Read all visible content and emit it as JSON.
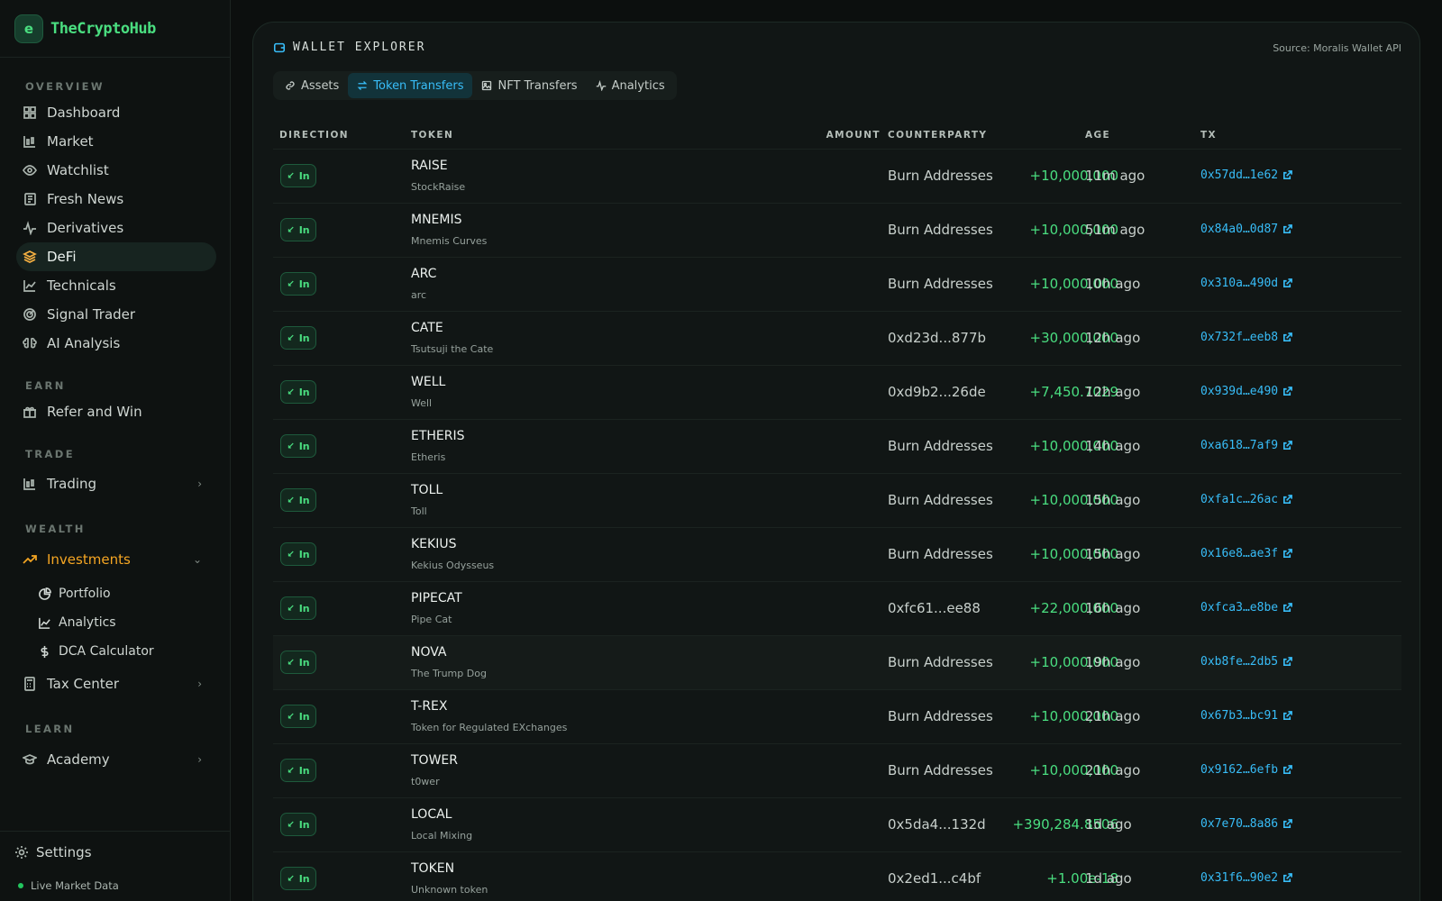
{
  "brand": {
    "name": "TheCryptoHub",
    "logo_glyph": "e"
  },
  "sidebar": {
    "sections": {
      "overview": "OVERVIEW",
      "earn": "EARN",
      "trade": "TRADE",
      "wealth": "WEALTH",
      "learn": "LEARN"
    },
    "overview_items": [
      {
        "label": "Dashboard",
        "icon": "grid-icon"
      },
      {
        "label": "Market",
        "icon": "candles-icon"
      },
      {
        "label": "Watchlist",
        "icon": "eye-icon"
      },
      {
        "label": "Fresh News",
        "icon": "newspaper-icon"
      },
      {
        "label": "Derivatives",
        "icon": "pulse-icon"
      },
      {
        "label": "DeFi",
        "icon": "layers-icon"
      },
      {
        "label": "Technicals",
        "icon": "line-chart-icon"
      },
      {
        "label": "Signal Trader",
        "icon": "radar-icon"
      },
      {
        "label": "AI Analysis",
        "icon": "brain-icon"
      }
    ],
    "earn_items": [
      {
        "label": "Refer and Win",
        "icon": "gift-icon"
      }
    ],
    "trade_items": [
      {
        "label": "Trading",
        "icon": "candles-icon"
      }
    ],
    "wealth_items": [
      {
        "label": "Investments",
        "icon": "trending-up-icon"
      },
      {
        "label": "Portfolio",
        "icon": "pie-icon"
      },
      {
        "label": "Analytics",
        "icon": "line-chart-icon"
      },
      {
        "label": "DCA Calculator",
        "icon": "dollar-icon"
      },
      {
        "label": "Tax Center",
        "icon": "calculator-icon"
      }
    ],
    "learn_items": [
      {
        "label": "Academy",
        "icon": "graduation-cap-icon"
      }
    ],
    "footer": {
      "settings": "Settings",
      "live": "Live Market Data"
    }
  },
  "panel": {
    "title": "WALLET EXPLORER",
    "source": "Source: Moralis Wallet API",
    "tabs": [
      {
        "label": "Assets",
        "icon": "link-icon"
      },
      {
        "label": "Token Transfers",
        "icon": "swap-icon"
      },
      {
        "label": "NFT Transfers",
        "icon": "image-icon"
      },
      {
        "label": "Analytics",
        "icon": "pulse-icon"
      }
    ],
    "active_tab": "Token Transfers",
    "columns": {
      "direction": "DIRECTION",
      "token": "TOKEN",
      "amount": "AMOUNT",
      "counterparty": "COUNTERPARTY",
      "age": "AGE",
      "tx": "TX"
    },
    "rows": [
      {
        "dir": "In",
        "sym": "RAISE",
        "name": "StockRaise",
        "amount": "+10,000,000",
        "cp": "Burn Addresses",
        "age": "11m ago",
        "tx": "0x57dd…1e62"
      },
      {
        "dir": "In",
        "sym": "MNEMIS",
        "name": "Mnemis Curves",
        "amount": "+10,000,000",
        "cp": "Burn Addresses",
        "age": "51m ago",
        "tx": "0x84a0…0d87"
      },
      {
        "dir": "In",
        "sym": "ARC",
        "name": "arc",
        "amount": "+10,000,000",
        "cp": "Burn Addresses",
        "age": "10h ago",
        "tx": "0x310a…490d"
      },
      {
        "dir": "In",
        "sym": "CATE",
        "name": "Tsutsuji the Cate",
        "amount": "+30,000,000",
        "cp": "0xd23d...877b",
        "age": "12h ago",
        "tx": "0x732f…eeb8"
      },
      {
        "dir": "In",
        "sym": "WELL",
        "name": "Well",
        "amount": "+7,450.7029",
        "cp": "0xd9b2...26de",
        "age": "12h ago",
        "tx": "0x939d…e490"
      },
      {
        "dir": "In",
        "sym": "ETHERIS",
        "name": "Etheris",
        "amount": "+10,000,000",
        "cp": "Burn Addresses",
        "age": "14h ago",
        "tx": "0xa618…7af9"
      },
      {
        "dir": "In",
        "sym": "TOLL",
        "name": "Toll",
        "amount": "+10,000,000",
        "cp": "Burn Addresses",
        "age": "15h ago",
        "tx": "0xfa1c…26ac"
      },
      {
        "dir": "In",
        "sym": "KEKIUS",
        "name": "Kekius Odysseus",
        "amount": "+10,000,000",
        "cp": "Burn Addresses",
        "age": "15h ago",
        "tx": "0x16e8…ae3f"
      },
      {
        "dir": "In",
        "sym": "PIPECAT",
        "name": "Pipe Cat",
        "amount": "+22,000,000",
        "cp": "0xfc61...ee88",
        "age": "16h ago",
        "tx": "0xfca3…e8be"
      },
      {
        "dir": "In",
        "sym": "NOVA",
        "name": "The Trump Dog",
        "amount": "+10,000,000",
        "cp": "Burn Addresses",
        "age": "19h ago",
        "tx": "0xb8fe…2db5"
      },
      {
        "dir": "In",
        "sym": "T-REX",
        "name": "Token for Regulated EXchanges",
        "amount": "+10,000,000",
        "cp": "Burn Addresses",
        "age": "21h ago",
        "tx": "0x67b3…bc91"
      },
      {
        "dir": "In",
        "sym": "TOWER",
        "name": "t0wer",
        "amount": "+10,000,000",
        "cp": "Burn Addresses",
        "age": "21h ago",
        "tx": "0x9162…6efb"
      },
      {
        "dir": "In",
        "sym": "LOCAL",
        "name": "Local Mixing",
        "amount": "+390,284.8506",
        "cp": "0x5da4...132d",
        "age": "1d ago",
        "tx": "0x7e70…8a86"
      },
      {
        "dir": "In",
        "sym": "TOKEN",
        "name": "Unknown token",
        "amount": "+1.00e-18",
        "cp": "0x2ed1...c4bf",
        "age": "1d ago",
        "tx": "0x31f6…90e2"
      }
    ]
  },
  "colors": {
    "accent_green": "#4ade80",
    "accent_blue": "#38bdf8",
    "accent_orange": "#f5a623",
    "background": "#0c0f0e"
  }
}
